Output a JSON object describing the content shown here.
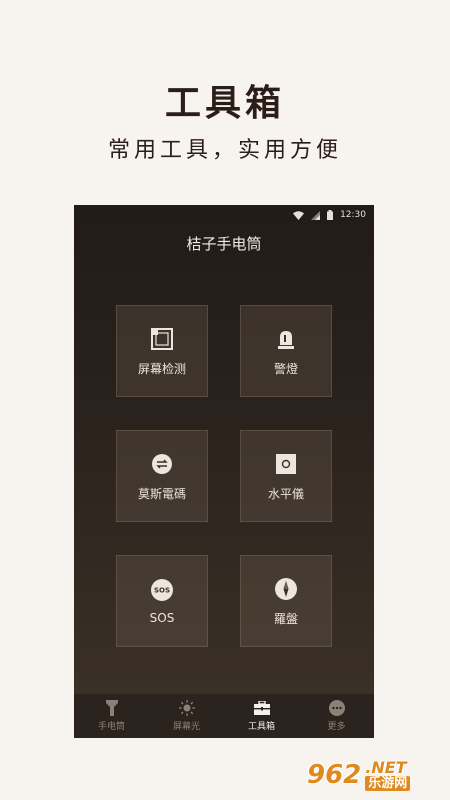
{
  "promo": {
    "title": "工具箱",
    "subtitle": "常用工具，实用方便"
  },
  "status_bar": {
    "time": "12:30",
    "icons": [
      "wifi-icon",
      "signal-icon",
      "battery-icon"
    ]
  },
  "app": {
    "title": "桔子手电筒"
  },
  "tools": [
    {
      "label": "屏幕检测",
      "icon": "screen-frame-icon"
    },
    {
      "label": "警燈",
      "icon": "alarm-light-icon"
    },
    {
      "label": "莫斯電碼",
      "icon": "morse-swap-icon"
    },
    {
      "label": "水平儀",
      "icon": "level-icon"
    },
    {
      "label": "SOS",
      "icon": "sos-icon",
      "icon_text": "SOS"
    },
    {
      "label": "羅盤",
      "icon": "compass-icon"
    }
  ],
  "tabs": [
    {
      "label": "手电筒",
      "icon": "flashlight-icon",
      "active": false
    },
    {
      "label": "屏幕光",
      "icon": "sun-icon",
      "active": false
    },
    {
      "label": "工具箱",
      "icon": "toolbox-icon",
      "active": true
    },
    {
      "label": "更多",
      "icon": "more-icon",
      "active": false
    }
  ],
  "watermark": {
    "logo": "962",
    "suffix": ".NET",
    "site": "乐游网"
  },
  "colors": {
    "background": "#f7f3ef",
    "phone_dark": "#221b17",
    "accent_orange": "#e08a1e"
  }
}
